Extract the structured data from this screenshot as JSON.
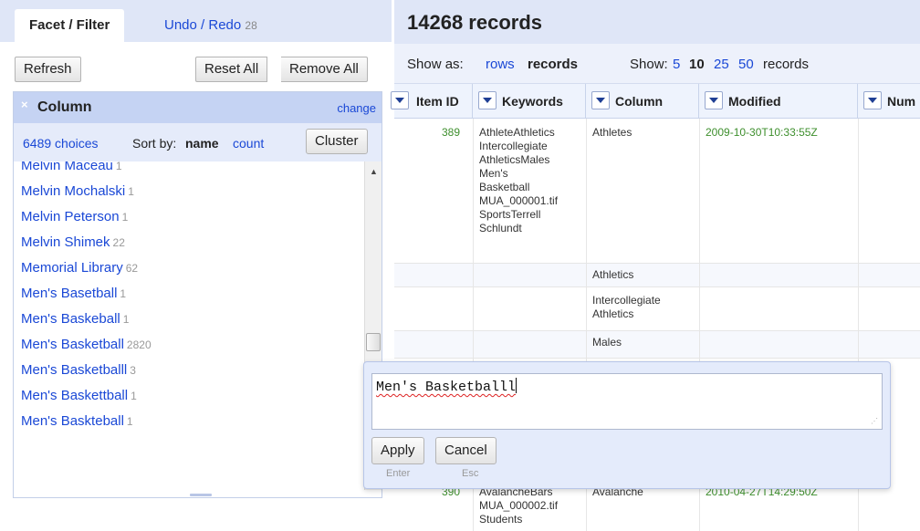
{
  "left_panel": {
    "tabs": [
      {
        "label": "Facet / Filter"
      },
      {
        "label": "Undo / Redo",
        "count": "28"
      }
    ],
    "buttons": {
      "refresh": "Refresh",
      "reset_all": "Reset All",
      "remove_all": "Remove All"
    },
    "facet": {
      "close_icon": "×",
      "title": "Column",
      "change_label": "change",
      "choices": "6489 choices",
      "sort_by_label": "Sort by:",
      "sort_name": "name",
      "sort_count": "count",
      "cluster_label": "Cluster",
      "items": [
        {
          "name": "Melvin Maceau",
          "count": "1"
        },
        {
          "name": "Melvin Mochalski",
          "count": "1"
        },
        {
          "name": "Melvin Peterson",
          "count": "1"
        },
        {
          "name": "Melvin Shimek",
          "count": "22"
        },
        {
          "name": "Memorial Library",
          "count": "62"
        },
        {
          "name": "Men's Basetball",
          "count": "1"
        },
        {
          "name": "Men's Baskeball",
          "count": "1"
        },
        {
          "name": "Men's Basketball",
          "count": "2820"
        },
        {
          "name": "Men's Basketballl",
          "count": "3"
        },
        {
          "name": "Men's Baskettball",
          "count": "1"
        },
        {
          "name": "Men's Baskteball",
          "count": "1"
        }
      ]
    }
  },
  "right_panel": {
    "title": "14268 records",
    "view_bar": {
      "show_as_label": "Show as:",
      "rows_link": "rows",
      "records_current": "records",
      "show_label": "Show:",
      "page_sizes": [
        "5",
        "10",
        "25",
        "50"
      ],
      "page_size_selected": "10",
      "page_suffix": "records"
    },
    "columns": [
      "Item ID",
      "Keywords",
      "Column",
      "Modified",
      "Num"
    ],
    "rows": {
      "r1": {
        "item_id": "389",
        "keywords": [
          "AthleteAthletics",
          "Intercollegiate",
          "AthleticsMales",
          "Men's",
          "Basketball",
          "MUA_000001.tif",
          "SportsTerrell",
          "Schlundt"
        ],
        "column": "Athletes",
        "modified": "2009-10-30T10:33:55Z"
      },
      "r2": {
        "column": "Athletics"
      },
      "r3": {
        "column_line1": "Intercollegiate",
        "column_line2": "Athletics"
      },
      "r4": {
        "column": "Males"
      },
      "r_last": {
        "item_id": "390",
        "keywords": [
          "AvalancheBars",
          "MUA_000002.tif",
          "Students"
        ],
        "column": "Avalanche",
        "modified": "2010-04-27T14:29:50Z"
      }
    }
  },
  "edit_popup": {
    "value": "Men's Basketballl",
    "apply_label": "Apply",
    "apply_hint": "Enter",
    "cancel_label": "Cancel",
    "cancel_hint": "Esc"
  }
}
